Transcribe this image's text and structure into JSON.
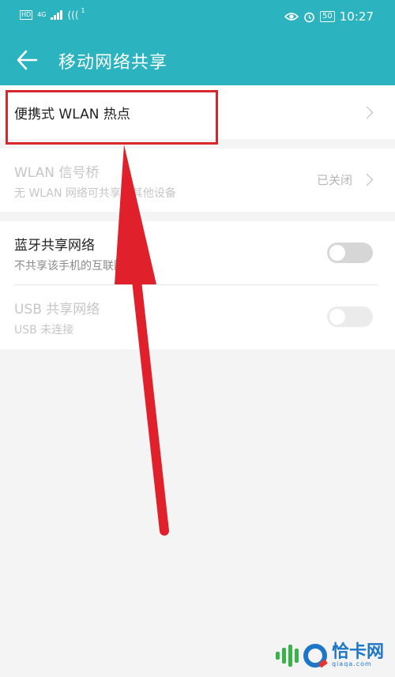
{
  "colors": {
    "header": "#2bb3bf",
    "annotation": "#d9262c",
    "disabled_text": "#c6c6c6"
  },
  "status_bar": {
    "hd": "HD",
    "network": "4G",
    "wifi_badge": "1",
    "battery": "50",
    "time": "10:27",
    "icons": [
      "signal-icon",
      "wifi-icon",
      "eye-comfort-icon",
      "alarm-icon",
      "battery-icon"
    ]
  },
  "header": {
    "title": "移动网络共享",
    "back_icon": "arrow-left-icon"
  },
  "items": [
    {
      "title": "便携式 WLAN 热点",
      "subtitle": "",
      "value": "",
      "control": "chevron",
      "enabled": true
    },
    {
      "title": "WLAN 信号桥",
      "subtitle": "无 WLAN 网络可共享给其他设备",
      "value": "已关闭",
      "control": "chevron",
      "enabled": false
    },
    {
      "title": "蓝牙共享网络",
      "subtitle": "不共享该手机的互联网连接",
      "control": "toggle",
      "toggle_on": false,
      "enabled": true
    },
    {
      "title": "USB 共享网络",
      "subtitle": "USB 未连接",
      "control": "toggle",
      "toggle_on": false,
      "enabled": false
    }
  ],
  "watermark": {
    "brand": "恰卡网",
    "url": "qiaqa.com"
  }
}
